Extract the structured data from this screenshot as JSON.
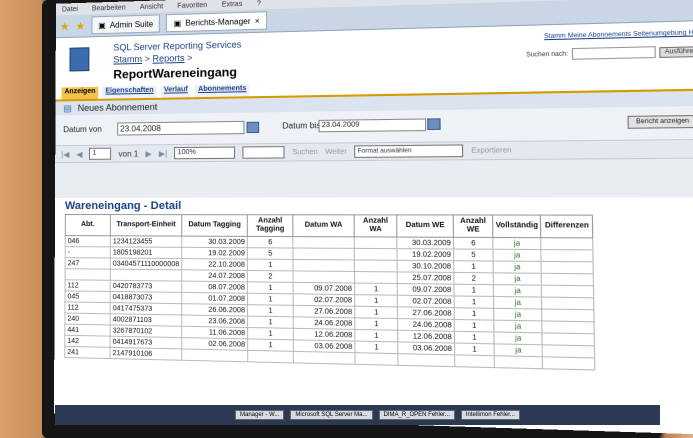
{
  "menu": [
    "Datei",
    "Bearbeiten",
    "Ansicht",
    "Favoriten",
    "Extras",
    "?"
  ],
  "browser_tabs": [
    {
      "label": "Admin Suite"
    },
    {
      "label": "Berichts-Manager"
    }
  ],
  "header": {
    "service_title": "SQL Server Reporting Services",
    "crumb_home": "Stamm",
    "crumb_reports": "Reports",
    "report_name": "ReportWareneingang",
    "links": "Stamm Meine Abonnements Seitenumgebung Hilfe",
    "search_label": "Suchen nach:",
    "search_button": "Ausführen"
  },
  "subtabs": [
    "Anzeigen",
    "Eigenschaften",
    "Verlauf",
    "Abonnements"
  ],
  "subscription_label": "Neues Abonnement",
  "params": {
    "from_label": "Datum von",
    "from_value": "23.04.2008",
    "to_label": "Datum bis",
    "to_value": "23.04.2009",
    "show_button": "Bericht anzeigen"
  },
  "toolbar": {
    "page_value": "1",
    "page_of": "von 1",
    "zoom": "100%",
    "find": "Suchen",
    "next": "Weiter",
    "format": "Format auswählen",
    "export": "Exportieren"
  },
  "report": {
    "title": "Wareneingang - Detail",
    "columns": [
      "Abt.",
      "Transport-Einheit",
      "Datum Tagging",
      "Anzahl Tagging",
      "Datum WA",
      "Anzahl WA",
      "Datum WE",
      "Anzahl WE",
      "Vollständig",
      "Differenzen"
    ],
    "rows": [
      [
        "046",
        "1234123455",
        "30.03.2009",
        "6",
        "",
        "",
        "30.03.2009",
        "6",
        "ja",
        ""
      ],
      [
        "-",
        "1805198201",
        "19.02.2009",
        "5",
        "",
        "",
        "19.02.2009",
        "5",
        "ja",
        ""
      ],
      [
        "247",
        "03404571110000008",
        "22.10.2008",
        "1",
        "",
        "",
        "30.10.2008",
        "1",
        "ja",
        ""
      ],
      [
        "",
        "",
        "24.07.2008",
        "2",
        "",
        "",
        "25.07.2008",
        "2",
        "ja",
        ""
      ],
      [
        "112",
        "0420783773",
        "08.07.2008",
        "1",
        "09.07.2008",
        "1",
        "09.07.2008",
        "1",
        "ja",
        ""
      ],
      [
        "045",
        "0418873073",
        "01.07.2008",
        "1",
        "02.07.2008",
        "1",
        "02.07.2008",
        "1",
        "ja",
        ""
      ],
      [
        "112",
        "0417475373",
        "26.06.2008",
        "1",
        "27.06.2008",
        "1",
        "27.06.2008",
        "1",
        "ja",
        ""
      ],
      [
        "240",
        "4002871103",
        "23.06.2008",
        "1",
        "24.06.2008",
        "1",
        "24.06.2008",
        "1",
        "ja",
        ""
      ],
      [
        "441",
        "3267870102",
        "11.06.2008",
        "1",
        "12.06.2008",
        "1",
        "12.06.2008",
        "1",
        "ja",
        ""
      ],
      [
        "142",
        "0414917673",
        "02.06.2008",
        "1",
        "03.06.2008",
        "1",
        "03.06.2008",
        "1",
        "ja",
        ""
      ],
      [
        "241",
        "2147910106",
        "",
        "",
        "",
        "",
        "",
        "",
        "",
        ""
      ]
    ]
  },
  "taskbar": [
    "Manager - W...",
    "Microsoft SQL Server Ma...",
    "DIMA_R_OPEN Fehler...",
    "Intellimon Fehler..."
  ]
}
